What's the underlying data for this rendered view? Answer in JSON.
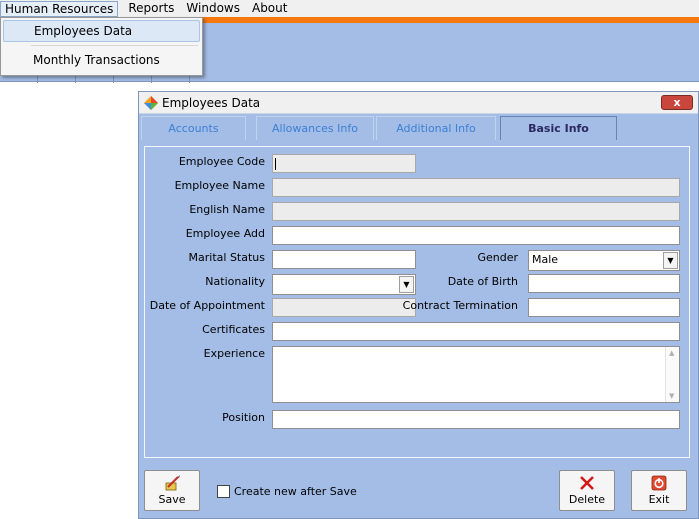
{
  "menubar": {
    "items": [
      "Human Resources",
      "Reports",
      "Windows",
      "About"
    ]
  },
  "dropdown": {
    "items": [
      "Employees Data",
      "Monthly Transactions"
    ]
  },
  "window": {
    "title": "Employees Data",
    "close_label": "x"
  },
  "tabs": [
    {
      "label": "Accounts",
      "selected": false
    },
    {
      "label": "Allowances Info",
      "selected": false
    },
    {
      "label": "Additional Info",
      "selected": false
    },
    {
      "label": "Basic Info",
      "selected": true
    }
  ],
  "form": {
    "employee_code_label": "Employee Code",
    "employee_name_label": "Employee Name",
    "english_name_label": "English Name",
    "employee_add_label": "Employee Add",
    "marital_status_label": "Marital Status",
    "gender_label": "Gender",
    "gender_value": "Male",
    "nationality_label": "Nationality",
    "date_of_birth_label": "Date of Birth",
    "date_of_appointment_label": "Date of Appointment",
    "contract_termination_label": "Contract Termination",
    "certificates_label": "Certificates",
    "experience_label": "Experience",
    "position_label": "Position"
  },
  "footer": {
    "save_label": "Save",
    "create_new_label": "Create new after Save",
    "delete_label": "Delete",
    "exit_label": "Exit"
  },
  "colors": {
    "accent_orange": "#f7780e",
    "mdi_blue": "#a4bde6",
    "tab_text": "#3b7fd6",
    "delete_red": "#d11b1b"
  }
}
